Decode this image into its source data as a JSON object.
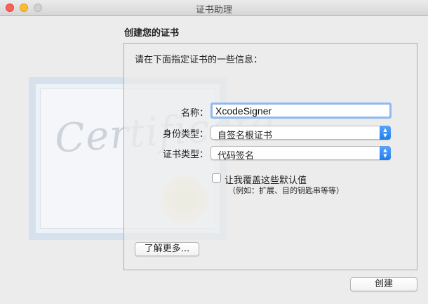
{
  "window": {
    "title": "证书助理"
  },
  "section_title": "创建您的证书",
  "background": {
    "certificate_word": "Certificate"
  },
  "form": {
    "intro": "请在下面指定证书的一些信息：",
    "name_label": "名称：",
    "name_value": "XcodeSigner",
    "identity_type_label": "身份类型：",
    "identity_type_value": "自签名根证书",
    "cert_type_label": "证书类型：",
    "cert_type_value": "代码签名",
    "override_label": "让我覆盖这些默认值",
    "override_note": "（例如：扩展、目的钥匙串等等）",
    "override_checked": false
  },
  "buttons": {
    "learn_more": "了解更多...",
    "create": "创建"
  }
}
